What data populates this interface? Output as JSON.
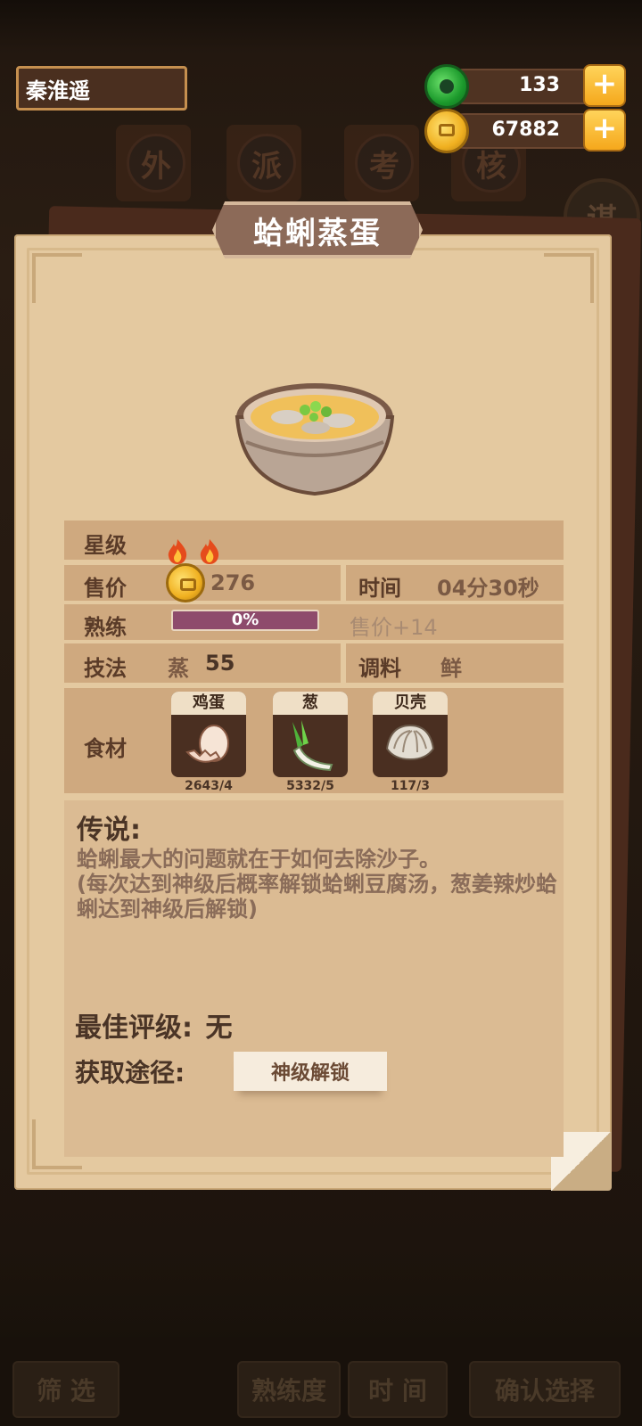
{
  "player": {
    "name": "秦淮遥"
  },
  "resources": {
    "jade": "133",
    "coins": "67882",
    "plus_label": "+"
  },
  "background": {
    "banners": [
      "外",
      "派",
      "考",
      "核"
    ],
    "round_sign": "谋",
    "bottom_buttons": [
      "筛 选",
      "熟练度",
      "时 间",
      "确认选择"
    ]
  },
  "recipe": {
    "title": "蛤蜊蒸蛋",
    "star_label": "星级",
    "stars": 2,
    "price_label": "售价",
    "price": "276",
    "time_label": "时间",
    "time": "04分30秒",
    "mastery_label": "熟练",
    "mastery_percent": 0,
    "mastery_text": "0%",
    "mastery_bonus": "售价+14",
    "technique_label": "技法",
    "technique": "蒸",
    "technique_value": "55",
    "seasoning_label": "调料",
    "seasoning": "鲜",
    "ingredients_label": "食材",
    "ingredients": [
      {
        "name": "鸡蛋",
        "count": "2643/4",
        "icon": "egg-icon"
      },
      {
        "name": "葱",
        "count": "5332/5",
        "icon": "scallion-icon"
      },
      {
        "name": "贝壳",
        "count": "117/3",
        "icon": "clam-icon"
      }
    ],
    "lore_title": "传说:",
    "lore_text": "蛤蜊最大的问题就在于如何去除沙子。\n(每次达到神级后概率解锁蛤蜊豆腐汤，葱姜辣炒蛤蜊达到神级后解锁)",
    "best_rating_label": "最佳评级:",
    "best_rating": "无",
    "obtain_label": "获取途径:",
    "obtain_button": "神级解锁"
  },
  "colors": {
    "accent": "#8c6a58",
    "paper": "#e4c9a0",
    "row": "#cfa97f",
    "progress": "#8e4b6c"
  }
}
